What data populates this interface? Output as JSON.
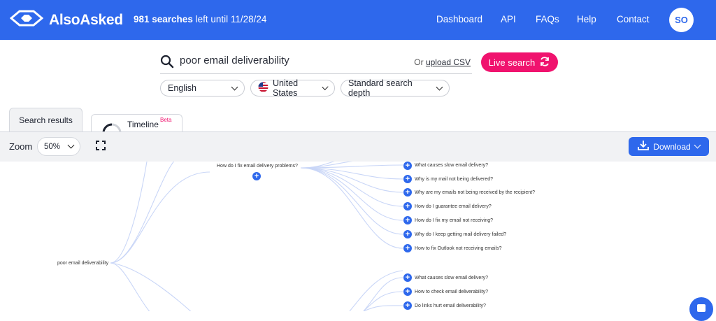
{
  "header": {
    "logo_text": "AlsoAsked",
    "searches_count": "981 searches",
    "searches_suffix": "left until 11/28/24",
    "nav": [
      "Dashboard",
      "API",
      "FAQs",
      "Help",
      "Contact"
    ],
    "avatar_initials": "SO",
    "brand_color": "#2e68ec"
  },
  "search": {
    "query": "poor email deliverability",
    "or_text": "Or",
    "upload_link": "upload CSV",
    "live_button": "Live search",
    "language": "English",
    "country": "United States",
    "depth": "Standard search depth"
  },
  "tabs": {
    "results": "Search results",
    "timeline": "Timeline",
    "timeline_badge": "Beta"
  },
  "toolbar": {
    "zoom_label": "Zoom",
    "zoom_value": "50%",
    "download_label": "Download"
  },
  "tree": {
    "root": "poor email deliverability",
    "branch1": {
      "question": "How do I fix email delivery problems?",
      "children": [
        "What causes slow email delivery?",
        "Why is my mail not being delivered?",
        "Why are my emails not being received by the recipient?",
        "How do I guarantee email delivery?",
        "How do I fix my email not receiving?",
        "Why do I keep getting mail delivery failed?",
        "How to fix Outlook not receiving emails?"
      ]
    },
    "branch2": {
      "children": [
        "What causes slow email delivery?",
        "How to check email deliverability?",
        "Do links hurt email deliverability?"
      ]
    }
  }
}
